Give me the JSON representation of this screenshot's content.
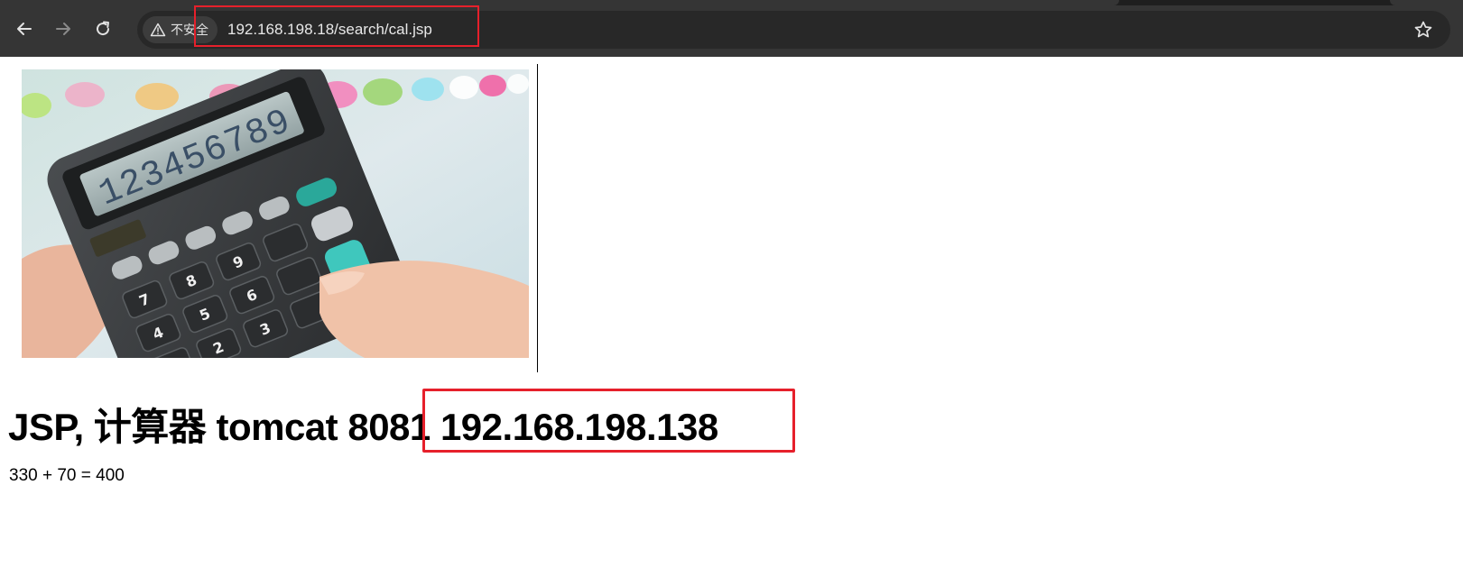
{
  "browser": {
    "security_label": "不安全",
    "url": "192.168.198.18/search/cal.jsp",
    "icons": {
      "back": "back-arrow-icon",
      "forward": "forward-arrow-icon",
      "reload": "reload-icon",
      "warning": "warning-triangle-icon",
      "bookmark": "star-icon"
    },
    "highlight_color": "#e6202b"
  },
  "page": {
    "image_subject": "calculator",
    "calculator_display": "123456789",
    "heading_prefix": "JSP, 计算器 tomcat 8081 ",
    "heading_ip": "192.168.198.138",
    "result": "330 + 70 = 400"
  }
}
